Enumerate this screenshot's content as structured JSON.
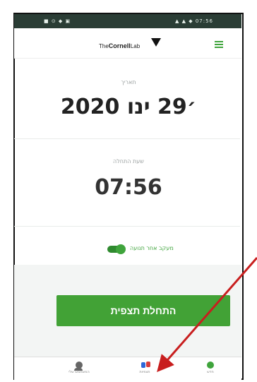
{
  "status_bar": {
    "left": "■ ⊙ ◆ ▣",
    "right": "▲ ▲ ◆ 07:56"
  },
  "header": {
    "brand_prefix": "The",
    "brand_name": "Cornell",
    "brand_suffix": "Lab"
  },
  "date": {
    "label": "תאריך",
    "value": "2020 ׳29 ינו"
  },
  "time": {
    "label": "שעת התחלה",
    "value": "07:56"
  },
  "toggle": {
    "label": "מעקב אחר תנועה"
  },
  "actions": {
    "start_label": "התחלת תצפית"
  },
  "bottom_nav": {
    "items": [
      {
        "label": "המשתמש שלי"
      },
      {
        "label": "תצפיות"
      },
      {
        "label": "חדש"
      }
    ]
  },
  "colors": {
    "accent": "#42a236",
    "status_bar": "#2a3d35",
    "arrow": "#c81e1e"
  }
}
